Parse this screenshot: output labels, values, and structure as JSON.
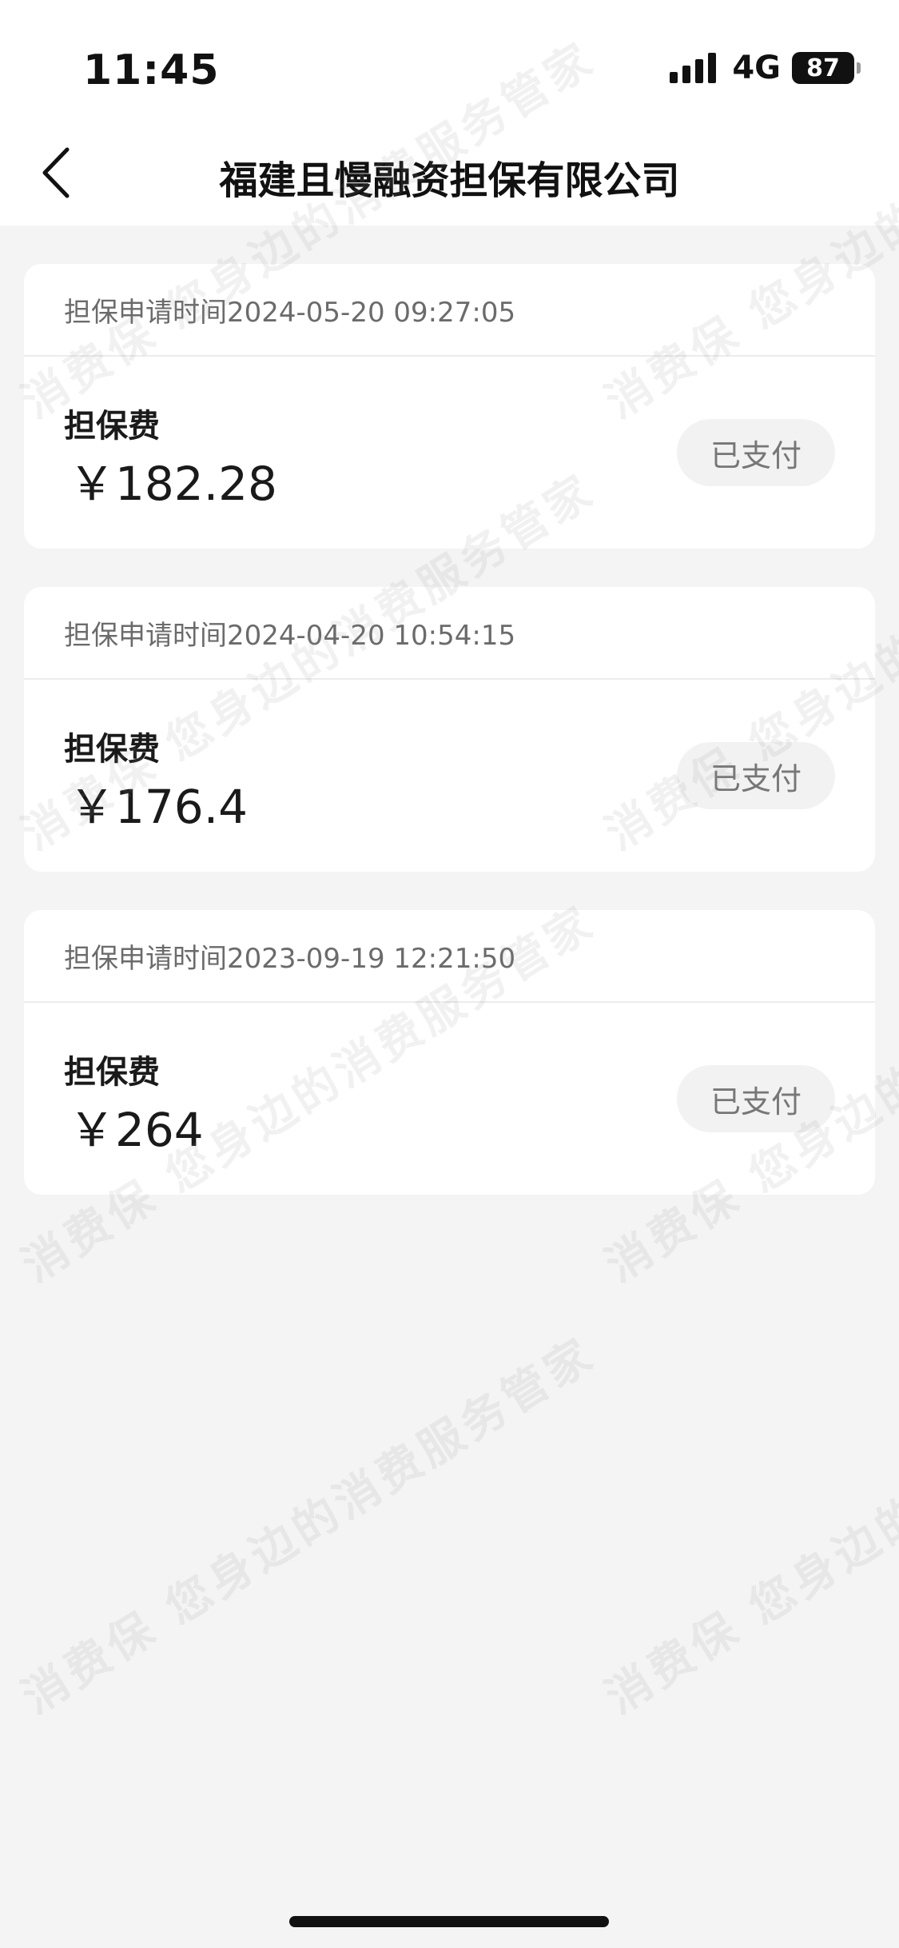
{
  "status_bar": {
    "time": "11:45",
    "network": "4G",
    "battery": "87",
    "signal_icon": "signal-bars-icon"
  },
  "nav": {
    "back_icon": "chevron-left-icon",
    "title": "福建且慢融资担保有限公司"
  },
  "records": [
    {
      "header": "担保申请时间2024-05-20 09:27:05",
      "fee_label": "担保费",
      "amount": "￥182.28",
      "status": "已支付"
    },
    {
      "header": "担保申请时间2024-04-20 10:54:15",
      "fee_label": "担保费",
      "amount": "￥176.4",
      "status": "已支付"
    },
    {
      "header": "担保申请时间2023-09-19 12:21:50",
      "fee_label": "担保费",
      "amount": "￥264",
      "status": "已支付"
    }
  ],
  "watermark": {
    "text_a": "消费保 您身边的消费服务管家",
    "text_b": "消费保 您身边的消费服务管家"
  },
  "colors": {
    "background": "#f4f4f4",
    "card": "#ffffff",
    "badge_bg": "#f2f2f2",
    "badge_text": "#777777"
  }
}
